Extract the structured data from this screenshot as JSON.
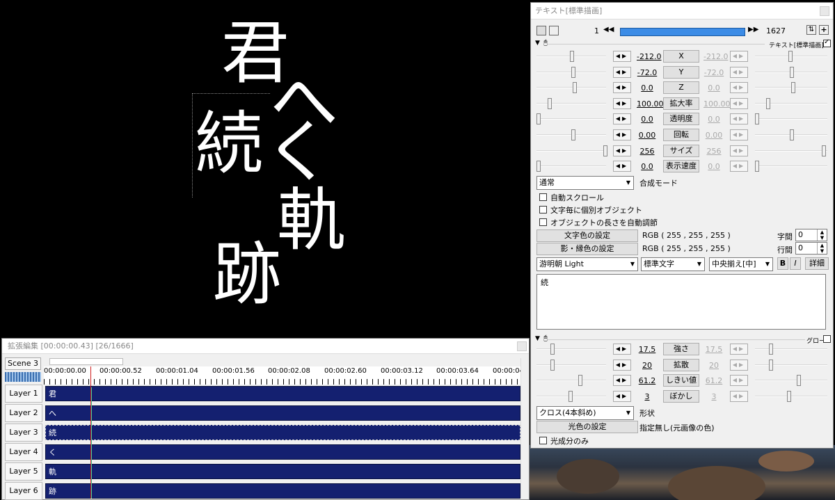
{
  "preview": {
    "chars": [
      "君",
      "へ",
      "続",
      "く",
      "軌",
      "跡"
    ]
  },
  "timeline": {
    "title": "拡張編集 [00:00:00.43] [26/1666]",
    "scene": "Scene 3",
    "ruler": [
      "00:00:00.00",
      "00:00:00.52",
      "00:00:01.04",
      "00:00:01.56",
      "00:00:02.08",
      "00:00:02.60",
      "00:00:03.12",
      "00:00:03.64",
      "00:00:04"
    ],
    "layers": [
      {
        "label": "Layer 1",
        "clip": "君"
      },
      {
        "label": "Layer 2",
        "clip": "へ"
      },
      {
        "label": "Layer 3",
        "clip": "続"
      },
      {
        "label": "Layer 4",
        "clip": "く"
      },
      {
        "label": "Layer 5",
        "clip": "軌"
      },
      {
        "label": "Layer 6",
        "clip": "跡"
      }
    ]
  },
  "props": {
    "title": "テキスト[標準描画]",
    "frame_start": "1",
    "frame_end": "1627",
    "header_right": "テキスト[標準描画]",
    "params": [
      {
        "left": "-212.0",
        "label": "X",
        "right": "-212.0"
      },
      {
        "left": "-72.0",
        "label": "Y",
        "right": "-72.0"
      },
      {
        "left": "0.0",
        "label": "Z",
        "right": "0.0"
      },
      {
        "left": "100.00",
        "label": "拡大率",
        "right": "100.00"
      },
      {
        "left": "0.0",
        "label": "透明度",
        "right": "0.0"
      },
      {
        "left": "0.00",
        "label": "回転",
        "right": "0.00"
      },
      {
        "left": "256",
        "label": "サイズ",
        "right": "256"
      },
      {
        "left": "0.0",
        "label": "表示速度",
        "right": "0.0"
      }
    ],
    "blend_mode": "通常",
    "blend_label": "合成モード",
    "chk_auto_scroll": "自動スクロール",
    "chk_individual": "文字毎に個別オブジェクト",
    "chk_auto_length": "オブジェクトの長さを自動調節",
    "text_color_btn": "文字色の設定",
    "text_color_val": "RGB ( 255 , 255 , 255 )",
    "shadow_color_btn": "影・縁色の設定",
    "shadow_color_val": "RGB ( 255 , 255 , 255 )",
    "char_spacing_label": "字間",
    "char_spacing": "0",
    "line_spacing_label": "行間",
    "line_spacing": "0",
    "font": "游明朝 Light",
    "style": "標準文字",
    "align": "中央揃え[中]",
    "bold": "B",
    "italic": "I",
    "detail": "詳細",
    "text": "続",
    "filter_label": "グロー",
    "filter_params": [
      {
        "left": "17.5",
        "label": "強さ",
        "right": "17.5"
      },
      {
        "left": "20",
        "label": "拡散",
        "right": "20"
      },
      {
        "left": "61.2",
        "label": "しきい値",
        "right": "61.2"
      },
      {
        "left": "3",
        "label": "ぼかし",
        "right": "3"
      }
    ],
    "shape": "クロス(4本斜め)",
    "shape_label": "形状",
    "glow_color_btn": "光色の設定",
    "glow_color_val": "指定無し(元画像の色)",
    "glow_only": "光成分のみ"
  }
}
